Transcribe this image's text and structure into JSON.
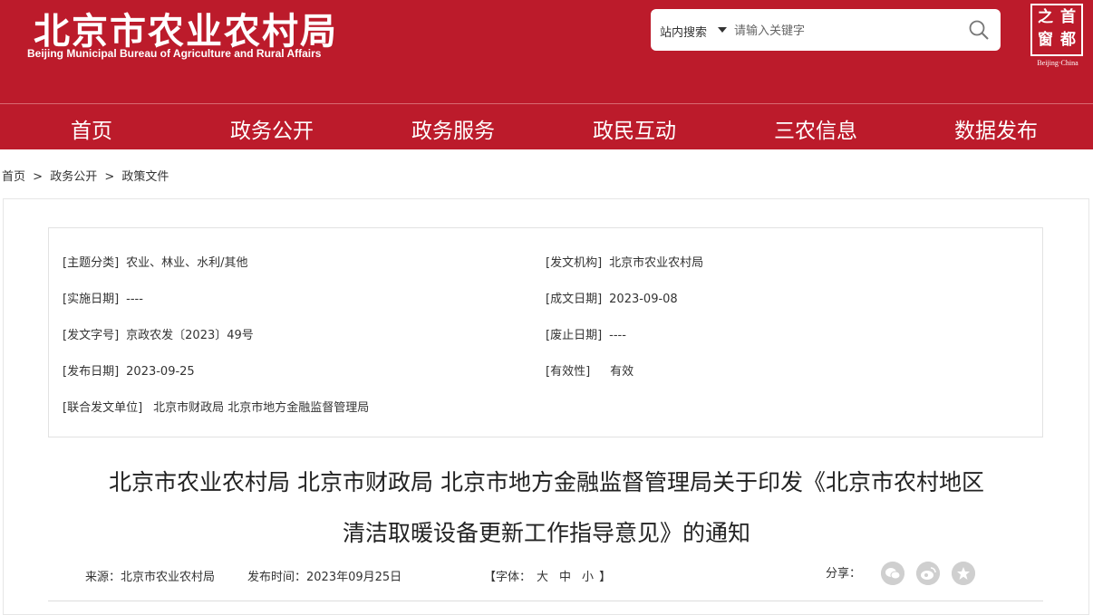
{
  "header": {
    "logo_cn": "北京市农业农村局",
    "logo_en": "Beijing Municipal Bureau of Agriculture and Rural Affairs",
    "seal_chars": [
      "首",
      "都",
      "之",
      "窗"
    ],
    "seal_en": "Beijing·China"
  },
  "search": {
    "scope": "站内搜索",
    "placeholder": "请输入关键字"
  },
  "nav": [
    "首页",
    "政务公开",
    "政务服务",
    "政民互动",
    "三农信息",
    "数据发布"
  ],
  "breadcrumb": [
    "首页",
    ">",
    "政务公开",
    ">",
    "政策文件"
  ],
  "meta": {
    "topic_label": "[主题分类]",
    "topic_value": "农业、林业、水利/其他",
    "issuer_label": "[发文机构]",
    "issuer_value": "北京市农业农村局",
    "impl_label": "[实施日期]",
    "impl_value": "----",
    "written_label": "[成文日期]",
    "written_value": "2023-09-08",
    "docno_label": "[发文字号]",
    "docno_value": "京政农发〔2023〕49号",
    "abolish_label": "[废止日期]",
    "abolish_value": "----",
    "pubdate_label": "[发布日期]",
    "pubdate_value": "2023-09-25",
    "valid_label": "[有效性]",
    "valid_value": "有效",
    "joint_label": "[联合发文单位]",
    "joint_value": "北京市财政局 北京市地方金融监督管理局"
  },
  "article": {
    "title_line1": "北京市农业农村局 北京市财政局 北京市地方金融监督管理局关于印发《北京市农村地区",
    "title_line2": "清洁取暖设备更新工作指导意见》的通知",
    "source": "来源：北京市农业农村局",
    "time": "发布时间：2023年09月25日",
    "font_label": "【字体：",
    "font_large": "大",
    "font_mid": "中",
    "font_small": "小",
    "font_end": "】",
    "share_label": "分享："
  },
  "colors": {
    "brand_red": "#bc1b2b"
  },
  "share_icons": [
    "wechat-icon",
    "weibo-icon",
    "favorite-icon"
  ]
}
